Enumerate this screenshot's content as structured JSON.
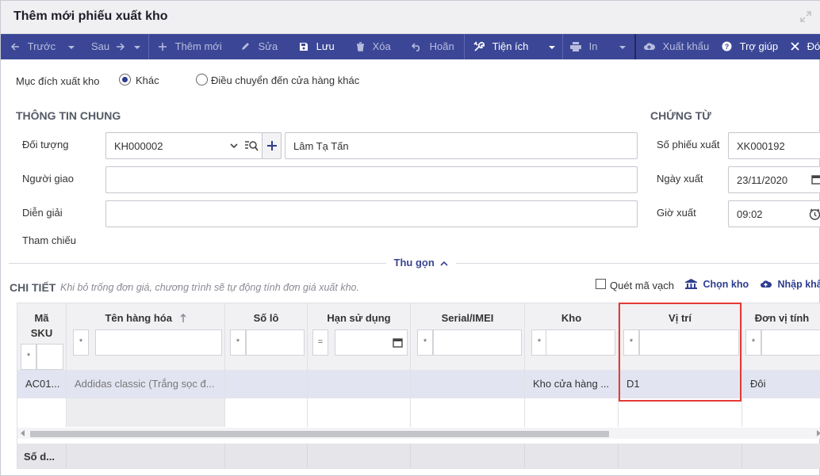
{
  "window": {
    "title": "Thêm mới phiếu xuất kho"
  },
  "toolbar": {
    "prev": "Trước",
    "next": "Sau",
    "add": "Thêm mới",
    "edit": "Sửa",
    "save": "Lưu",
    "delete": "Xóa",
    "undo": "Hoãn",
    "utilities": "Tiện ích",
    "print": "In",
    "export": "Xuất khẩu",
    "help": "Trợ giúp",
    "close": "Đón"
  },
  "purpose": {
    "label": "Mục đích xuất kho",
    "option_other": "Khác",
    "option_transfer": "Điều chuyển đến cửa hàng khác",
    "selected": "Khác"
  },
  "general": {
    "title": "THÔNG TIN CHUNG",
    "object_label": "Đối tượng",
    "object_code": "KH000002",
    "object_name": "Lâm Tạ Tấn",
    "deliverer_label": "Người giao",
    "deliverer_value": "",
    "description_label": "Diễn giải",
    "description_value": "",
    "reference_label": "Tham chiếu"
  },
  "voucher": {
    "title": "CHỨNG TỪ",
    "number_label": "Số phiếu xuất",
    "number_value": "XK000192",
    "date_label": "Ngày xuất",
    "date_value": "23/11/2020",
    "time_label": "Giờ xuất",
    "time_value": "09:02"
  },
  "collapse": {
    "label": "Thu gọn"
  },
  "detail": {
    "title": "CHI TIẾT",
    "hint": "Khi bỏ trống đơn giá, chương trình sẽ tự động tính đơn giá xuất kho.",
    "barcode_label": "Quét mã vạch",
    "choose_warehouse": "Chọn kho",
    "import_label": "Nhập khẩu"
  },
  "grid": {
    "columns": {
      "sku": "Mã SKU",
      "name": "Tên hàng hóa",
      "lot": "Số lô",
      "expiry": "Hạn sử dụng",
      "serial": "Serial/IMEI",
      "warehouse": "Kho",
      "location": "Vị trí",
      "unit": "Đơn vị tính"
    },
    "filters": {
      "star": "*",
      "equals": "="
    },
    "rows": [
      {
        "sku": "AC01...",
        "name": "Addidas classic (Trắng sọc đ...",
        "lot": "",
        "expiry": "",
        "serial": "",
        "warehouse": "Kho cửa hàng ...",
        "location": "D1",
        "unit": "Đôi"
      }
    ],
    "footer_label": "Số d..."
  },
  "colors": {
    "toolbar_bg": "#3b4796",
    "accent": "#3a4590",
    "selected_row": "#e3e4f1",
    "highlight_border": "#e53935"
  }
}
